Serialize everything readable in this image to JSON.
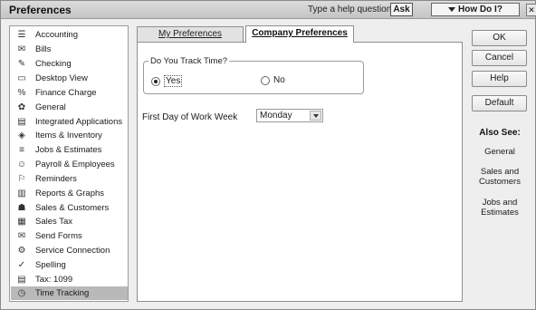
{
  "window": {
    "title": "Preferences",
    "help_prompt": "Type a help question",
    "ask_label": "Ask",
    "how_do_i_label": "How Do I?",
    "close_glyph": "✕"
  },
  "preferences": {
    "items": [
      {
        "label": "Accounting",
        "icon": "ledger-icon",
        "glyph": "☰",
        "selected": false
      },
      {
        "label": "Bills",
        "icon": "bills-icon",
        "glyph": "✉",
        "selected": false
      },
      {
        "label": "Checking",
        "icon": "checkbook-icon",
        "glyph": "✎",
        "selected": false
      },
      {
        "label": "Desktop View",
        "icon": "desktop-icon",
        "glyph": "▭",
        "selected": false
      },
      {
        "label": "Finance Charge",
        "icon": "finance-icon",
        "glyph": "%",
        "selected": false
      },
      {
        "label": "General",
        "icon": "general-icon",
        "glyph": "✿",
        "selected": false
      },
      {
        "label": "Integrated Applications",
        "icon": "apps-icon",
        "glyph": "▤",
        "selected": false
      },
      {
        "label": "Items & Inventory",
        "icon": "inventory-icon",
        "glyph": "◈",
        "selected": false
      },
      {
        "label": "Jobs & Estimates",
        "icon": "jobs-icon",
        "glyph": "≡",
        "selected": false
      },
      {
        "label": "Payroll & Employees",
        "icon": "payroll-icon",
        "glyph": "☺",
        "selected": false
      },
      {
        "label": "Reminders",
        "icon": "reminders-icon",
        "glyph": "⚐",
        "selected": false
      },
      {
        "label": "Reports & Graphs",
        "icon": "reports-icon",
        "glyph": "▥",
        "selected": false
      },
      {
        "label": "Sales & Customers",
        "icon": "sales-icon",
        "glyph": "☗",
        "selected": false
      },
      {
        "label": "Sales Tax",
        "icon": "tax-icon",
        "glyph": "▦",
        "selected": false
      },
      {
        "label": "Send Forms",
        "icon": "forms-icon",
        "glyph": "✉",
        "selected": false
      },
      {
        "label": "Service Connection",
        "icon": "connection-icon",
        "glyph": "⚙",
        "selected": false
      },
      {
        "label": "Spelling",
        "icon": "spelling-icon",
        "glyph": "✓",
        "selected": false
      },
      {
        "label": "Tax: 1099",
        "icon": "tax-form-icon",
        "glyph": "▤",
        "selected": false
      },
      {
        "label": "Time Tracking",
        "icon": "clock-icon",
        "glyph": "◷",
        "selected": true
      }
    ]
  },
  "tabs": {
    "my_preferences": "My Preferences",
    "company_preferences": "Company Preferences",
    "active": "company_preferences"
  },
  "track_time": {
    "group_title": "Do You Track Time?",
    "yes_label": "Yes",
    "no_label": "No",
    "selected": "yes"
  },
  "work_week": {
    "label": "First Day of Work Week",
    "value": "Monday"
  },
  "buttons": {
    "ok": "OK",
    "cancel": "Cancel",
    "help": "Help",
    "default": "Default"
  },
  "also_see": {
    "title": "Also See:",
    "links": [
      "General",
      "Sales and Customers",
      "Jobs and Estimates"
    ]
  }
}
